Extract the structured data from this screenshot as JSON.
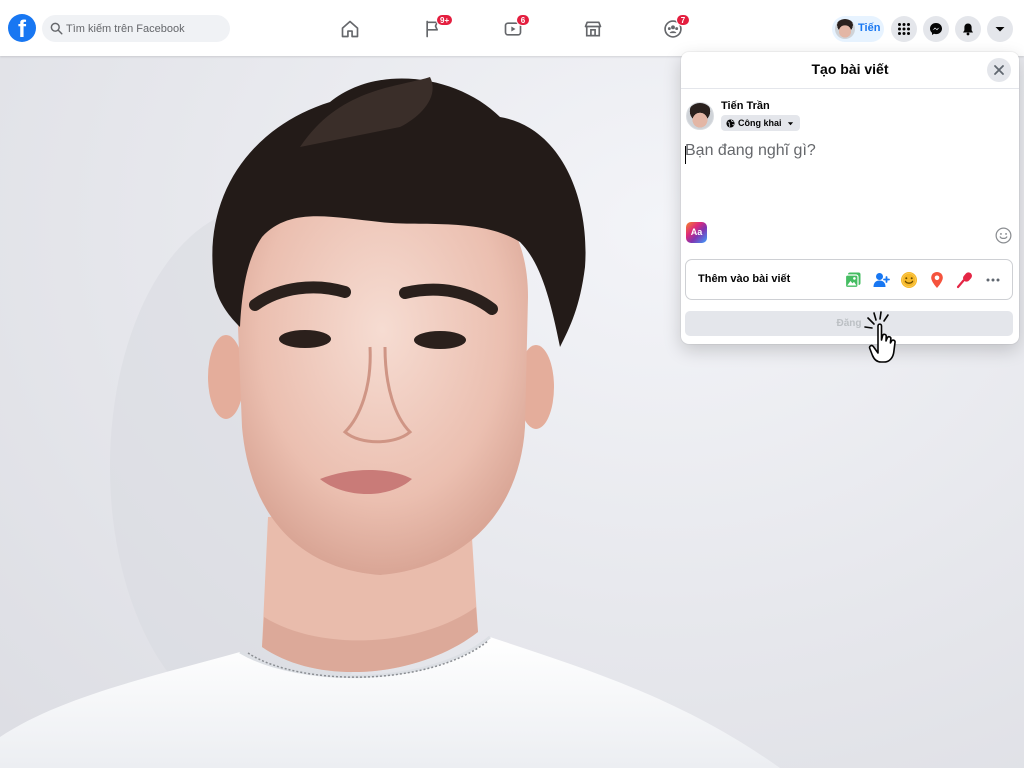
{
  "topbar": {
    "logo": "f",
    "search_placeholder": "Tìm kiếm trên Facebook",
    "nav": [
      {
        "name": "home-icon",
        "badge": ""
      },
      {
        "name": "pages-flag-icon",
        "badge": "9+"
      },
      {
        "name": "watch-video-icon",
        "badge": "6"
      },
      {
        "name": "marketplace-store-icon",
        "badge": ""
      },
      {
        "name": "groups-icon",
        "badge": "7"
      }
    ],
    "profile_name": "Tiến",
    "right_buttons": [
      "menu-grid-icon",
      "messenger-icon",
      "notifications-bell-icon",
      "account-caret-icon"
    ]
  },
  "dialog": {
    "title": "Tạo bài viết",
    "author_name": "Tiến Trần",
    "audience_label": "Công khai",
    "composer_placeholder": "Bạn đang nghĩ gì?",
    "text_format_label": "Aa",
    "add_to_post_label": "Thêm vào bài viết",
    "attachments": [
      "photo-video-icon",
      "tag-people-icon",
      "feeling-activity-icon",
      "check-in-icon",
      "live-video-icon",
      "more-icon"
    ],
    "post_button_label": "Đăng"
  },
  "colors": {
    "brand_blue": "#1877f2",
    "badge_red": "#e41e3f",
    "photo_green": "#45bd62",
    "feeling_yellow": "#f7b928",
    "checkin_red": "#f5533d",
    "live_red": "#e42645",
    "disabled_button": "#e4e6eb"
  }
}
